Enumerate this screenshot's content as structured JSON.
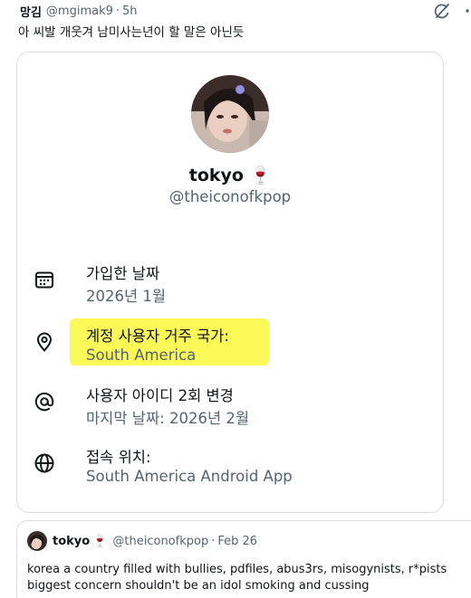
{
  "post": {
    "author_name": "망김",
    "author_handle": "@mgimak9",
    "separator": "·",
    "time": "5h",
    "text": "아 씨발 개웃겨 남미사는년이 할 말은 아닌듯",
    "icons": {
      "grok": "slash-circle-icon",
      "more": "more-dots-icon"
    }
  },
  "profile": {
    "name": "tokyo",
    "emoji": "🍷",
    "handle": "@theiconofkpop",
    "rows": [
      {
        "icon": "calendar-icon",
        "title": "가입한 날짜",
        "sub": "2026년 1월"
      },
      {
        "icon": "location-pin-icon",
        "title": "계정 사용자 거주 국가:",
        "sub": "South America",
        "highlight": "#fbf84a"
      },
      {
        "icon": "at-sign-icon",
        "title": "사용자 아이디 2회 변경",
        "sub": "마지막 날짜: 2026년 2월"
      },
      {
        "icon": "globe-icon",
        "title": "접속 위치:",
        "sub": "South America Android App"
      }
    ]
  },
  "quote": {
    "name": "tokyo",
    "emoji": "🍷",
    "handle": "@theiconofkpop",
    "separator": "·",
    "date": "Feb 26",
    "line1": "korea a country filled with bullies, pdfiles, abus3rs, misogynists, r*pists",
    "line2": "biggest concern shouldn't be an idol smoking and cussing"
  },
  "colors": {
    "text": "#0f1419",
    "secondary": "#536471",
    "border": "#d9dde1",
    "highlight": "#fbf84a"
  }
}
